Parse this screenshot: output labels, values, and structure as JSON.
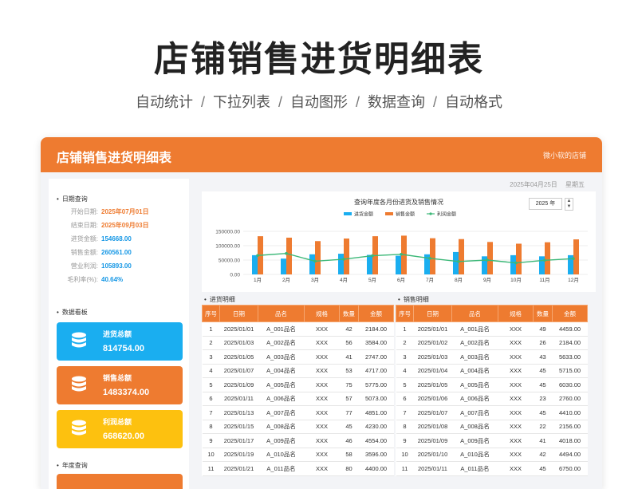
{
  "hero": {
    "title": "店铺销售进货明细表",
    "features": [
      "自动统计",
      "下拉列表",
      "自动图形",
      "数据查询",
      "自动格式"
    ],
    "separator": "/"
  },
  "header": {
    "title": "店铺销售进货明细表",
    "shop": "微小软的店铺"
  },
  "today": {
    "date": "2025年04月25日",
    "weekday": "星期五"
  },
  "date_query": {
    "section": "日期查询",
    "rows": [
      {
        "key": "开始日期:",
        "value": "2025年07月01日"
      },
      {
        "key": "结束日期:",
        "value": "2025年09月03日"
      },
      {
        "key": "进货金额:",
        "value": "154668.00"
      },
      {
        "key": "销售金额:",
        "value": "260561.00"
      },
      {
        "key": "营业利润:",
        "value": "105893.00"
      },
      {
        "key": "毛利率(%):",
        "value": "40.64%"
      }
    ]
  },
  "dashboard": {
    "section": "数据看板",
    "tiles": [
      {
        "label": "进货总额",
        "value": "814754.00",
        "color": "#1aaef0",
        "icon": "database-icon"
      },
      {
        "label": "销售总额",
        "value": "1483374.00",
        "color": "#ee7b30",
        "icon": "database-icon"
      },
      {
        "label": "利润总额",
        "value": "668620.00",
        "color": "#fdc10f",
        "icon": "database-icon"
      }
    ]
  },
  "year_query": {
    "section": "年度查询"
  },
  "chart": {
    "title": "查询年度各月份进货及销售情况",
    "year_value": "2025 年",
    "spin_up": "▲",
    "spin_down": "▼"
  },
  "chart_data": {
    "type": "bar",
    "categories": [
      "1月",
      "2月",
      "3月",
      "4月",
      "5月",
      "6月",
      "7月",
      "8月",
      "9月",
      "10月",
      "11月",
      "12月"
    ],
    "series": [
      {
        "name": "进货金额",
        "type": "bar",
        "color": "#1aaef0",
        "values": [
          67000,
          55000,
          70000,
          72000,
          68000,
          65000,
          70000,
          78000,
          63000,
          67000,
          63000,
          67000
        ]
      },
      {
        "name": "销售金额",
        "type": "bar",
        "color": "#ee7b30",
        "values": [
          133000,
          128000,
          116000,
          125000,
          133000,
          135000,
          126000,
          123000,
          113000,
          107000,
          112000,
          122000
        ]
      },
      {
        "name": "利润金额",
        "type": "line",
        "color": "#3cb878",
        "values": [
          66000,
          73000,
          46000,
          53000,
          65000,
          70000,
          56000,
          45000,
          50000,
          40000,
          49000,
          55000
        ]
      }
    ],
    "yticks": [
      "0.00",
      "50000.00",
      "100000.00",
      "150000.00"
    ],
    "ylim": [
      0,
      150000
    ],
    "legend": "top"
  },
  "purchase": {
    "title": "进货明细",
    "headers": [
      "序号",
      "日期",
      "品名",
      "规格",
      "数量",
      "金额"
    ],
    "rows": [
      [
        "1",
        "2025/01/01",
        "A_001品名",
        "XXX",
        "42",
        "2184.00"
      ],
      [
        "2",
        "2025/01/03",
        "A_002品名",
        "XXX",
        "56",
        "3584.00"
      ],
      [
        "3",
        "2025/01/05",
        "A_003品名",
        "XXX",
        "41",
        "2747.00"
      ],
      [
        "4",
        "2025/01/07",
        "A_004品名",
        "XXX",
        "53",
        "4717.00"
      ],
      [
        "5",
        "2025/01/09",
        "A_005品名",
        "XXX",
        "75",
        "5775.00"
      ],
      [
        "6",
        "2025/01/11",
        "A_006品名",
        "XXX",
        "57",
        "5073.00"
      ],
      [
        "7",
        "2025/01/13",
        "A_007品名",
        "XXX",
        "77",
        "4851.00"
      ],
      [
        "8",
        "2025/01/15",
        "A_008品名",
        "XXX",
        "45",
        "4230.00"
      ],
      [
        "9",
        "2025/01/17",
        "A_009品名",
        "XXX",
        "46",
        "4554.00"
      ],
      [
        "10",
        "2025/01/19",
        "A_010品名",
        "XXX",
        "58",
        "3596.00"
      ],
      [
        "11",
        "2025/01/21",
        "A_011品名",
        "XXX",
        "80",
        "4400.00"
      ]
    ]
  },
  "sales": {
    "title": "销售明细",
    "headers": [
      "序号",
      "日期",
      "品名",
      "规格",
      "数量",
      "金额"
    ],
    "rows": [
      [
        "1",
        "2025/01/01",
        "A_001品名",
        "XXX",
        "49",
        "4459.00"
      ],
      [
        "2",
        "2025/01/02",
        "A_002品名",
        "XXX",
        "26",
        "2184.00"
      ],
      [
        "3",
        "2025/01/03",
        "A_003品名",
        "XXX",
        "43",
        "5633.00"
      ],
      [
        "4",
        "2025/01/04",
        "A_004品名",
        "XXX",
        "45",
        "5715.00"
      ],
      [
        "5",
        "2025/01/05",
        "A_005品名",
        "XXX",
        "45",
        "6030.00"
      ],
      [
        "6",
        "2025/01/06",
        "A_006品名",
        "XXX",
        "23",
        "2760.00"
      ],
      [
        "7",
        "2025/01/07",
        "A_007品名",
        "XXX",
        "45",
        "4410.00"
      ],
      [
        "8",
        "2025/01/08",
        "A_008品名",
        "XXX",
        "22",
        "2156.00"
      ],
      [
        "9",
        "2025/01/09",
        "A_009品名",
        "XXX",
        "41",
        "4018.00"
      ],
      [
        "10",
        "2025/01/10",
        "A_010品名",
        "XXX",
        "42",
        "4494.00"
      ],
      [
        "11",
        "2025/01/11",
        "A_011品名",
        "XXX",
        "45",
        "6750.00"
      ]
    ]
  }
}
